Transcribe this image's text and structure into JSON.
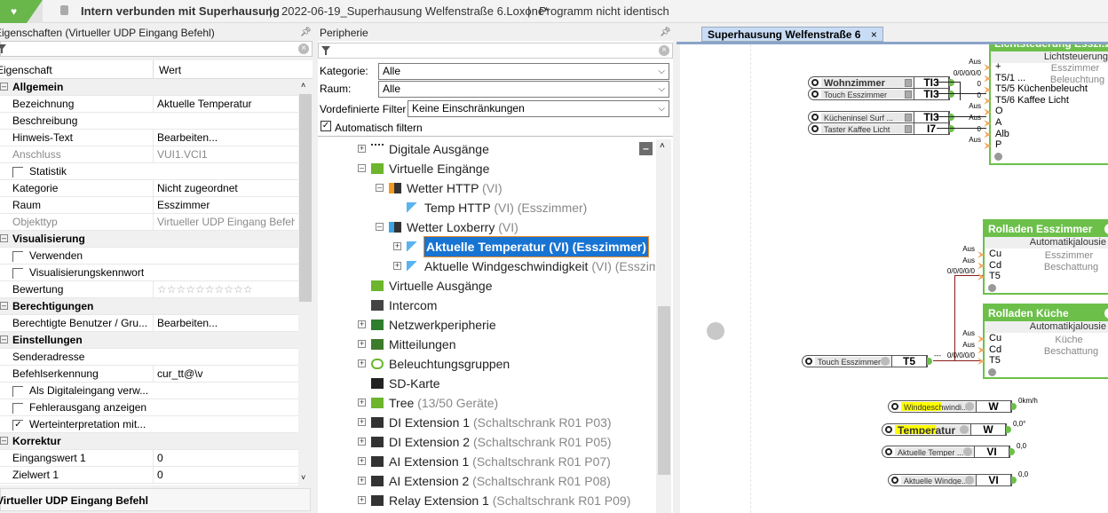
{
  "topbar": {
    "status": "Intern verbunden mit Superhausung",
    "file": "2022-06-19_Superhausung Welfenstraße 6.Loxone*",
    "program": "Programm nicht identisch",
    "sep": "|"
  },
  "properties": {
    "title": "Eigenschaften (Virtueller UDP Eingang Befehl)",
    "col_key": "Eigenschaft",
    "col_value": "Wert",
    "description": "Virtueller UDP Eingang Befehl",
    "rows": [
      {
        "type": "section",
        "key": "Allgemein"
      },
      {
        "type": "row",
        "key": "Bezeichnung",
        "value": "Aktuelle Temperatur"
      },
      {
        "type": "row",
        "key": "Beschreibung",
        "value": ""
      },
      {
        "type": "row",
        "key": "Hinweis-Text",
        "value": "Bearbeiten..."
      },
      {
        "type": "disabled",
        "key": "Anschluss",
        "value": "VUI1.VCI1"
      },
      {
        "type": "checkbox",
        "key": "Statistik",
        "checked": false
      },
      {
        "type": "row",
        "key": "Kategorie",
        "value": "Nicht zugeordnet"
      },
      {
        "type": "row",
        "key": "Raum",
        "value": "Esszimmer"
      },
      {
        "type": "disabled",
        "key": "Objekttyp",
        "value": "Virtueller UDP Eingang Befehl"
      },
      {
        "type": "section",
        "key": "Visualisierung"
      },
      {
        "type": "checkbox",
        "key": "Verwenden",
        "checked": false
      },
      {
        "type": "checkbox",
        "key": "Visualisierungskennwort",
        "checked": false
      },
      {
        "type": "row",
        "key": "Bewertung",
        "value": "☆☆☆☆☆☆☆☆☆☆",
        "stars": 0
      },
      {
        "type": "section",
        "key": "Berechtigungen"
      },
      {
        "type": "row",
        "key": "Berechtigte Benutzer / Gru...",
        "value": "Bearbeiten..."
      },
      {
        "type": "section",
        "key": "Einstellungen"
      },
      {
        "type": "row",
        "key": "Senderadresse",
        "value": ""
      },
      {
        "type": "row",
        "key": "Befehlserkennung",
        "value": "cur_tt@\\v"
      },
      {
        "type": "checkbox",
        "key": "Als Digitaleingang verw...",
        "checked": false
      },
      {
        "type": "checkbox",
        "key": "Fehlerausgang anzeigen",
        "checked": false
      },
      {
        "type": "checkbox",
        "key": "Werteinterpretation mit...",
        "checked": true
      },
      {
        "type": "section",
        "key": "Korrektur"
      },
      {
        "type": "row",
        "key": "Eingangswert 1",
        "value": "0"
      },
      {
        "type": "row",
        "key": "Zielwert 1",
        "value": "0"
      }
    ]
  },
  "periphery": {
    "title": "Peripherie",
    "kategorie_label": "Kategorie:",
    "kategorie_value": "Alle",
    "raum_label": "Raum:",
    "raum_value": "Alle",
    "filter_label": "Vordefinierte Filter",
    "filter_value": "Keine Einschränkungen",
    "auto_filter_label": "Automatisch filtern",
    "auto_filter_checked": true,
    "tree": [
      {
        "label": "Digitale Ausgänge",
        "suffix": "",
        "level": 0,
        "exp": "+",
        "icon": "digital-output-icon"
      },
      {
        "label": "Virtuelle Eingänge",
        "suffix": "",
        "level": 0,
        "exp": "-",
        "icon": "virtual-input-icon"
      },
      {
        "label": "Wetter HTTP",
        "suffix": " (VI)",
        "level": 1,
        "exp": "-",
        "icon": "virtual-input-http-icon"
      },
      {
        "label": "Temp HTTP",
        "suffix": " (VI) (Esszimmer)",
        "level": 2,
        "exp": "",
        "icon": "analog-input-icon"
      },
      {
        "label": "Wetter Loxberry",
        "suffix": " (VI)",
        "level": 1,
        "exp": "-",
        "icon": "virtual-input-loxberry-icon"
      },
      {
        "label": "Aktuelle Temperatur (VI) (Esszimmer)",
        "suffix": "",
        "level": 2,
        "exp": "+",
        "icon": "analog-input-icon",
        "selected": true
      },
      {
        "label": "Aktuelle Windgeschwindigkeit",
        "suffix": " (VI) (Esszimmer)",
        "level": 2,
        "exp": "+",
        "icon": "analog-input-icon"
      },
      {
        "label": "Virtuelle Ausgänge",
        "suffix": "",
        "level": 0,
        "exp": "",
        "icon": "virtual-output-icon"
      },
      {
        "label": "Intercom",
        "suffix": "",
        "level": 0,
        "exp": "",
        "icon": "intercom-icon"
      },
      {
        "label": "Netzwerkperipherie",
        "suffix": "",
        "level": 0,
        "exp": "+",
        "icon": "network-icon"
      },
      {
        "label": "Mitteilungen",
        "suffix": "",
        "level": 0,
        "exp": "+",
        "icon": "messages-icon"
      },
      {
        "label": "Beleuchtungsgruppen",
        "suffix": "",
        "level": 0,
        "exp": "+",
        "icon": "lighting-groups-icon"
      },
      {
        "label": "SD-Karte",
        "suffix": "",
        "level": 0,
        "exp": "",
        "icon": "sd-card-icon"
      },
      {
        "label": "Tree",
        "suffix": "  (13/50 Geräte)",
        "level": 0,
        "exp": "+",
        "icon": "tree-icon"
      },
      {
        "label": "DI Extension 1",
        "suffix": " (Schaltschrank R01 P03)",
        "level": 0,
        "exp": "+",
        "icon": "extension-icon"
      },
      {
        "label": "DI Extension 2",
        "suffix": " (Schaltschrank R01 P05)",
        "level": 0,
        "exp": "+",
        "icon": "extension-icon"
      },
      {
        "label": "AI Extension 1",
        "suffix": " (Schaltschrank R01 P07)",
        "level": 0,
        "exp": "+",
        "icon": "extension-icon"
      },
      {
        "label": "AI Extension 2",
        "suffix": " (Schaltschrank R01 P08)",
        "level": 0,
        "exp": "+",
        "icon": "extension-icon"
      },
      {
        "label": "Relay Extension 1",
        "suffix": " (Schaltschrank R01 P09)",
        "level": 0,
        "exp": "+",
        "icon": "extension-icon"
      }
    ]
  },
  "canvas": {
    "tab": "Superhausung Welfenstraße 6",
    "tab_close": "×",
    "refs": [
      {
        "label": "Wohnzimmer",
        "code": "TI3",
        "value": ""
      },
      {
        "label": "Touch Esszimmer",
        "code": "TI3",
        "value": ""
      },
      {
        "label": "Kücheninsel  Surf ...",
        "code": "TI3",
        "value": ""
      },
      {
        "label": "Taster Kaffee Licht",
        "code": "I7",
        "value": ""
      },
      {
        "label": "Touch Esszimmer",
        "code": "T5",
        "value": "---"
      },
      {
        "label": "Windgeschwindi...",
        "code": "W",
        "value": "0km/h"
      },
      {
        "label": "Temperatur",
        "code": "W",
        "value": "0,0°"
      },
      {
        "label": "Aktuelle  Temper ...",
        "code": "VI",
        "value": "0,0"
      },
      {
        "label": "Aktuelle  Windge...",
        "code": "VI",
        "value": "0,0"
      }
    ],
    "blocks": [
      {
        "title": "Lichtsteuerung Esszi...",
        "type": "Lichtsteuerung",
        "room": "Esszimmer",
        "category": "Beleuchtung",
        "inputs": [
          {
            "name": "+",
            "val": "Aus"
          },
          {
            "name": "T5/1 ...",
            "val": "0/0/0/0/0"
          },
          {
            "name": "T5/5  Küchenbeleucht",
            "val": "0"
          },
          {
            "name": "T5/6  Kaffee Licht",
            "val": "0"
          },
          {
            "name": "O",
            "val": "Aus"
          },
          {
            "name": "A",
            "val": "Aus"
          },
          {
            "name": "Alb",
            "val": "0"
          },
          {
            "name": "P",
            "val": "Aus"
          }
        ]
      },
      {
        "title": "Rolladen Esszimmer",
        "type": "Automatikjalousie",
        "room": "Esszimmer",
        "category": "Beschattung",
        "inputs": [
          {
            "name": "Cu",
            "val": "Aus"
          },
          {
            "name": "Cd",
            "val": "Aus"
          },
          {
            "name": "T5",
            "val": "0/0/0/0/0"
          }
        ]
      },
      {
        "title": "Rolladen Küche",
        "type": "Automatikjalousie",
        "room": "Küche",
        "category": "Beschattung",
        "inputs": [
          {
            "name": "Cu",
            "val": "Aus"
          },
          {
            "name": "Cd",
            "val": "Aus"
          },
          {
            "name": "T5",
            "val": "0/0/0/0/0"
          }
        ]
      }
    ]
  }
}
